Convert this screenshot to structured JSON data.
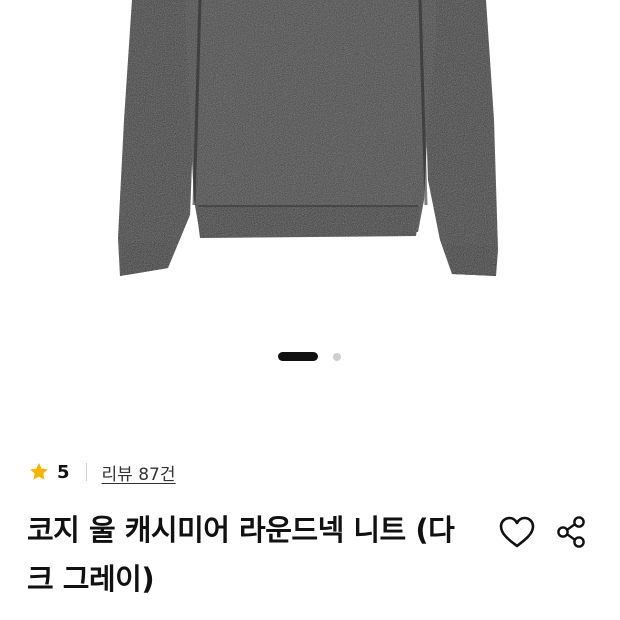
{
  "gallery": {
    "image_alt": "dark gray cozy wool cashmere round-neck knit sweater",
    "total_images": 2,
    "active_index": 1
  },
  "product": {
    "rating": "5",
    "review_text": "리뷰 87건",
    "title": "코지 울 캐시미어 라운드넥 니트 (다크 그레이)"
  },
  "colors": {
    "star": "#f5b400",
    "sweater": "#3a3a3a",
    "active_dot": "#111111",
    "inactive_dot": "#cfcfcf"
  },
  "icons": {
    "rating": "star-icon",
    "like": "heart-icon",
    "share": "share-icon"
  }
}
